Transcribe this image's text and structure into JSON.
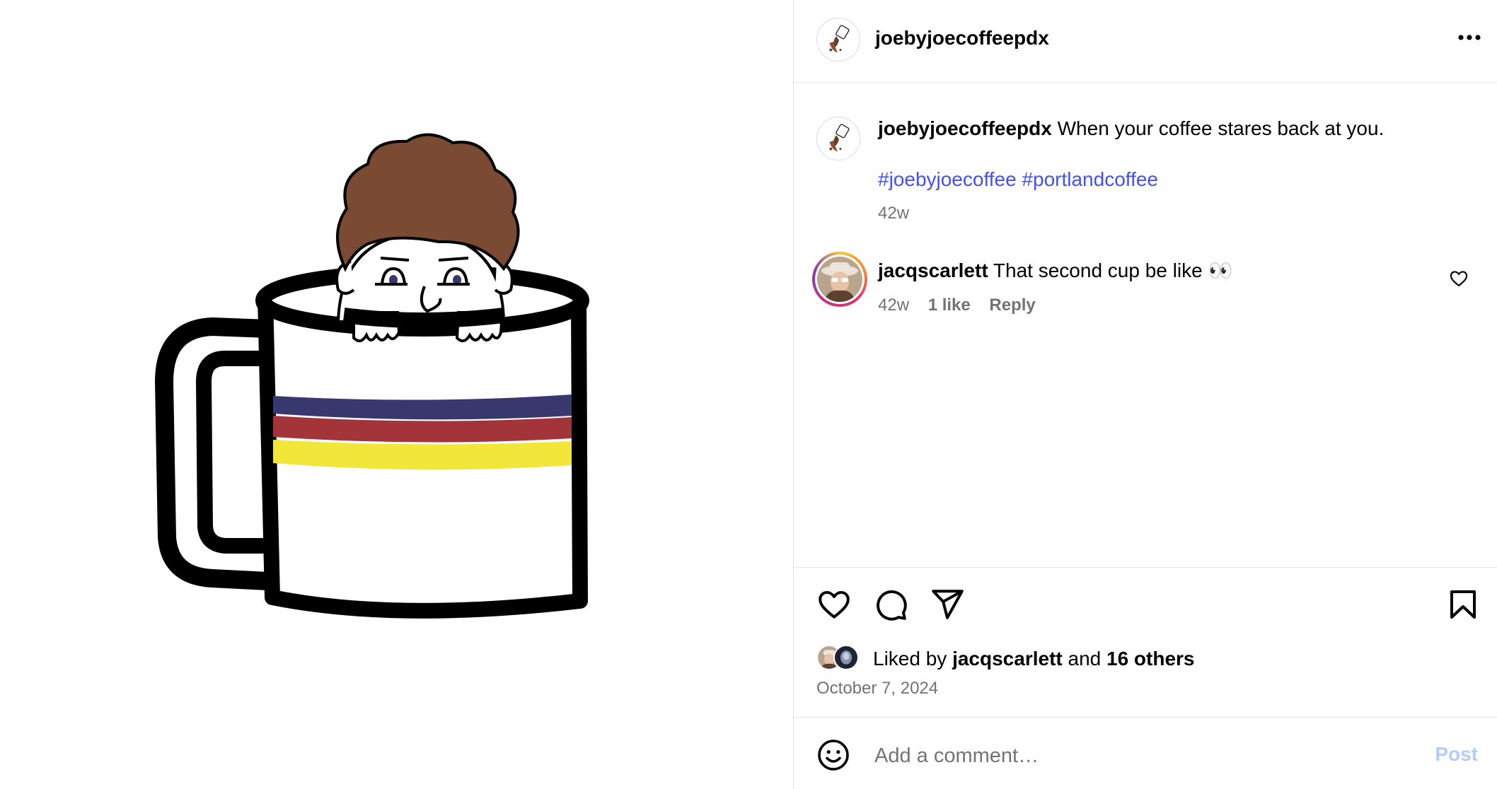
{
  "post": {
    "image": {
      "subject": "",
      "stripe_colors": [
        "#38386e",
        "#a3343a",
        "#f2e638"
      ],
      "hair_color": "#7a4a32"
    },
    "author": {
      "username": "joebyjoecoffeepdx",
      "avatar_icon": "coffee-pour-icon"
    },
    "more_icon": "more-options-icon"
  },
  "caption": {
    "username": "joebyjoecoffeepdx",
    "text": "When your coffee stares back at you.",
    "hashtags": [
      "#joebyjoecoffee",
      "#portlandcoffee"
    ],
    "time": "42w"
  },
  "comments": [
    {
      "username": "jacqscarlett",
      "text": "That second cup be like 👀",
      "time": "42w",
      "likes": "1 like",
      "reply_label": "Reply",
      "like_icon": "heart-outline-icon"
    }
  ],
  "actions": {
    "like_icon": "heart-icon",
    "comment_icon": "comment-icon",
    "share_icon": "send-icon",
    "save_icon": "bookmark-icon"
  },
  "likes": {
    "prefix": "Liked by",
    "user": "jacqscarlett",
    "connector": "and",
    "others": "16 others"
  },
  "date": "October 7, 2024",
  "add_comment": {
    "emoji_icon": "emoji-icon",
    "placeholder": "Add a comment…",
    "post_label": "Post"
  },
  "colors": {
    "link": "#4150f7",
    "muted": "#737373",
    "post_disabled": "#b3ccf9"
  }
}
